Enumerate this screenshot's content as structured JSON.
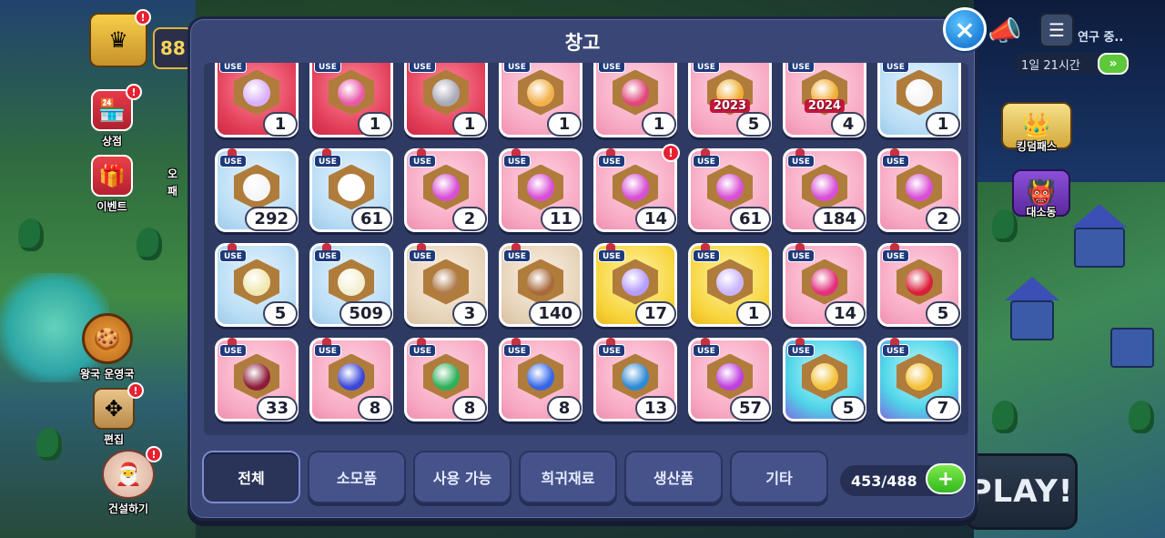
{
  "modal": {
    "title": "창고",
    "close_icon": "×"
  },
  "use_label": "USE",
  "items": [
    {
      "bg": "red",
      "icon": "gear-crest-icon",
      "core": "#d9b0ff",
      "count": "1"
    },
    {
      "bg": "red",
      "icon": "pink-crest-icon",
      "core": "#e85aa8",
      "count": "1"
    },
    {
      "bg": "red",
      "icon": "gray-crest-icon",
      "core": "#a9a9b8",
      "count": "1"
    },
    {
      "bg": "pink",
      "icon": "cookie-emblem-icon",
      "core": "#f2b14a",
      "count": "1"
    },
    {
      "bg": "pink",
      "icon": "cookie-emblem-icon",
      "core": "#e0477c",
      "count": "1"
    },
    {
      "bg": "pink",
      "icon": "cookie-emblem-icon",
      "core": "#f0b035",
      "count": "5",
      "year": "2023"
    },
    {
      "bg": "pink",
      "icon": "cookie-emblem-icon",
      "core": "#f0b035",
      "count": "4",
      "year": "2024"
    },
    {
      "bg": "blue",
      "icon": "silver-emblem-icon",
      "core": "#f5f5f5",
      "count": "1"
    },
    {
      "bg": "blue",
      "icon": "silver-emblem-icon",
      "core": "#f5f5f5",
      "count": "292"
    },
    {
      "bg": "blue",
      "icon": "silver-emblem-icon",
      "core": "#ffffff",
      "count": "61"
    },
    {
      "bg": "pink",
      "icon": "pink-pouch-icon",
      "core": "#d84fd6",
      "count": "2"
    },
    {
      "bg": "pink",
      "icon": "pink-pouch-icon",
      "core": "#d84fd6",
      "count": "11"
    },
    {
      "bg": "pink",
      "icon": "pink-pouch-icon",
      "core": "#d84fd6",
      "count": "14",
      "alert": "!"
    },
    {
      "bg": "pink",
      "icon": "pink-pouch-icon",
      "core": "#d84fd6",
      "count": "61"
    },
    {
      "bg": "pink",
      "icon": "pink-pouch-icon",
      "core": "#d84fd6",
      "count": "184"
    },
    {
      "bg": "pink",
      "icon": "pink-pouch-icon",
      "core": "#d84fd6",
      "count": "2"
    },
    {
      "bg": "blue",
      "icon": "cream-pouch-icon",
      "core": "#f0e8b0",
      "count": "5"
    },
    {
      "bg": "blue",
      "icon": "cream-pouch-icon",
      "core": "#f3efd0",
      "count": "509"
    },
    {
      "bg": "tan",
      "icon": "brown-pouch-icon",
      "core": "#b07a4a",
      "count": "3"
    },
    {
      "bg": "tan",
      "icon": "brown-pouch-icon",
      "core": "#a86a3c",
      "count": "140"
    },
    {
      "bg": "gold",
      "icon": "purple-crystal-icon",
      "core": "#b59cff",
      "count": "17"
    },
    {
      "bg": "gold",
      "icon": "lilac-flower-icon",
      "core": "#c9b4ff",
      "count": "1"
    },
    {
      "bg": "pink",
      "icon": "pink-gem-emblem-icon",
      "core": "#e2307c",
      "count": "14"
    },
    {
      "bg": "pink",
      "icon": "red-card-icon",
      "core": "#d91f3a",
      "count": "5"
    },
    {
      "bg": "pink",
      "icon": "crimson-card-icon",
      "core": "#8c1c3a",
      "count": "33"
    },
    {
      "bg": "pink",
      "icon": "blue-red-card-icon",
      "core": "#3a47d9",
      "count": "8"
    },
    {
      "bg": "pink",
      "icon": "rainbow-card-icon",
      "core": "#2fb05a",
      "count": "8"
    },
    {
      "bg": "pink",
      "icon": "blue-orange-card-icon",
      "core": "#3566e8",
      "count": "8"
    },
    {
      "bg": "pink",
      "icon": "teal-card-icon",
      "core": "#2e8ad6",
      "count": "13"
    },
    {
      "bg": "pink",
      "icon": "pink-sparkle-card-icon",
      "core": "#c03fe0",
      "count": "57"
    },
    {
      "bg": "teal",
      "icon": "gold-wing-crest-icon",
      "core": "#f3c23a",
      "count": "5"
    },
    {
      "bg": "teal",
      "icon": "gold-wing-crest-icon",
      "core": "#f3c23a",
      "count": "7"
    }
  ],
  "tabs": [
    {
      "label": "전체",
      "active": true
    },
    {
      "label": "소모품",
      "active": false
    },
    {
      "label": "사용 가능",
      "active": false
    },
    {
      "label": "희귀재료",
      "active": false
    },
    {
      "label": "생산품",
      "active": false
    },
    {
      "label": "기타",
      "active": false
    }
  ],
  "capacity": {
    "text": "453/488",
    "plus_label": "+"
  },
  "left_hud": {
    "top_number": "88",
    "shop_label": "상점",
    "event_label": "이벤트",
    "kingdom_label": "왕국 운영국",
    "edit_label": "편집",
    "build_label": "건설하기",
    "partial_label": "오",
    "partial_label2": "패",
    "notification": "!"
  },
  "right_hud": {
    "menu_text": "연구 중..",
    "timer": "1일 21시간",
    "kingdom_pass_label": "킹덤패스",
    "event_label": "대소동",
    "play_label": "PLAY!"
  },
  "colors": {
    "modal_bg": "#3a4776",
    "count_pill": "#ffffff",
    "plus_green": "#33b81f",
    "notification_red": "#e8202f"
  }
}
